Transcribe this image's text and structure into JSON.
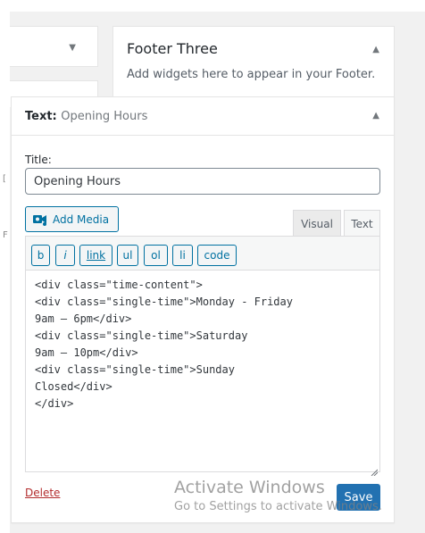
{
  "sidebar_footer_three": {
    "title": "Footer Three",
    "description": "Add widgets here to appear in your Footer."
  },
  "widget": {
    "type_label": "Text:",
    "instance_title": "Opening Hours",
    "title_label": "Title:",
    "title_value": "Opening Hours",
    "add_media_label": "Add Media",
    "tabs": {
      "visual": "Visual",
      "text": "Text"
    },
    "quicktags": [
      "b",
      "i",
      "link",
      "ul",
      "ol",
      "li",
      "code"
    ],
    "content": "<div class=\"time-content\">\n<div class=\"single-time\">Monday - Friday\n9am – 6pm</div>\n<div class=\"single-time\">Saturday\n9am – 10pm</div>\n<div class=\"single-time\">Sunday\nClosed</div>\n</div>",
    "delete_label": "Delete",
    "save_label": "Save"
  },
  "watermark": {
    "title": "Activate Windows",
    "subtitle": "Go to Settings to activate Windows."
  },
  "colors": {
    "accent": "#0071a1",
    "primary_button": "#2271b1",
    "delete": "#b32d2e"
  },
  "icons": {
    "collapse": "triangle-up-icon",
    "expand": "triangle-down-icon",
    "media": "media-camera-icon"
  }
}
